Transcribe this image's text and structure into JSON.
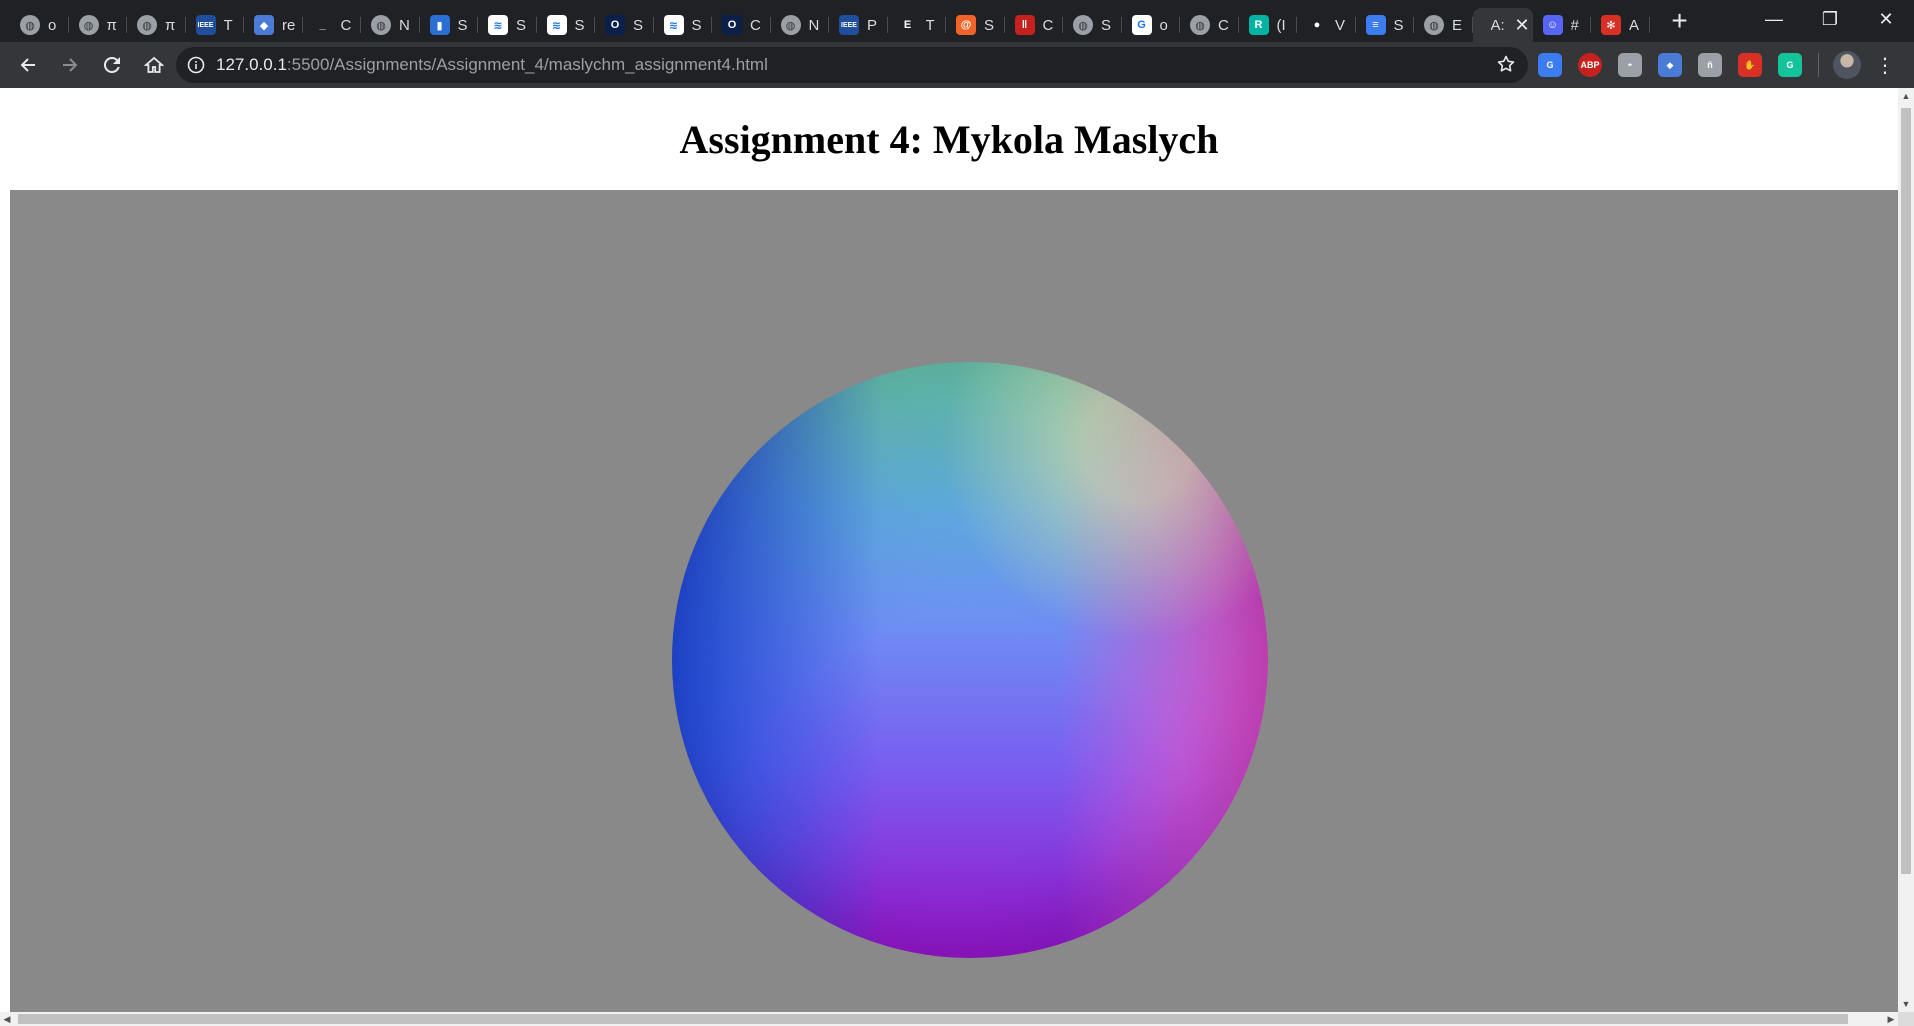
{
  "browser": {
    "tabs": [
      {
        "title": "o",
        "icon": "globe-icon",
        "color": "#5f6368",
        "glyph": "◍"
      },
      {
        "title": "π",
        "icon": "globe-icon",
        "color": "#5f6368",
        "glyph": "◍"
      },
      {
        "title": "π",
        "icon": "globe-icon",
        "color": "#5f6368",
        "glyph": "◍"
      },
      {
        "title": "T",
        "icon": "ieee-icon",
        "color": "#1f4e9c",
        "glyph": "IEEE"
      },
      {
        "title": "re",
        "icon": "graduation-cap-icon",
        "color": "#4a7bd6",
        "glyph": "◆"
      },
      {
        "title": "C",
        "icon": "underscore-icon",
        "color": "#202124",
        "glyph": "_"
      },
      {
        "title": "N",
        "icon": "globe-icon",
        "color": "#5f6368",
        "glyph": "◍"
      },
      {
        "title": "S",
        "icon": "bar-chart-icon",
        "color": "#2a6fd4",
        "glyph": "▮"
      },
      {
        "title": "S",
        "icon": "stack-icon",
        "color": "#ffffff",
        "glyph": "≋"
      },
      {
        "title": "S",
        "icon": "stack-icon",
        "color": "#ffffff",
        "glyph": "≋"
      },
      {
        "title": "S",
        "icon": "o-letter-icon",
        "color": "#0b1f4b",
        "glyph": "O"
      },
      {
        "title": "S",
        "icon": "stack-icon",
        "color": "#ffffff",
        "glyph": "≋"
      },
      {
        "title": "C",
        "icon": "o-letter-icon",
        "color": "#0b1f4b",
        "glyph": "O"
      },
      {
        "title": "N",
        "icon": "globe-icon",
        "color": "#5f6368",
        "glyph": "◍"
      },
      {
        "title": "P",
        "icon": "ieee-icon",
        "color": "#1f4e9c",
        "glyph": "IEEE"
      },
      {
        "title": "T",
        "icon": "e-letter-icon",
        "color": "#202124",
        "glyph": "E"
      },
      {
        "title": "S",
        "icon": "at-icon",
        "color": "#f0642a",
        "glyph": "@"
      },
      {
        "title": "C",
        "icon": "pause-bars-icon",
        "color": "#c5221f",
        "glyph": "‖"
      },
      {
        "title": "S",
        "icon": "globe-icon",
        "color": "#5f6368",
        "glyph": "◍"
      },
      {
        "title": "o",
        "icon": "google-icon",
        "color": "#ffffff",
        "glyph": "G"
      },
      {
        "title": "C",
        "icon": "globe-icon",
        "color": "#5f6368",
        "glyph": "◍"
      },
      {
        "title": "(I",
        "icon": "researchgate-icon",
        "color": "#00b3a4",
        "glyph": "R"
      },
      {
        "title": "V",
        "icon": "github-icon",
        "color": "#202124",
        "glyph": "●"
      },
      {
        "title": "S",
        "icon": "docs-icon",
        "color": "#3b7cf0",
        "glyph": "≡"
      },
      {
        "title": "E",
        "icon": "globe-icon",
        "color": "#5f6368",
        "glyph": "◍"
      },
      {
        "title": "A:",
        "icon": "",
        "color": "",
        "glyph": "",
        "active": true
      },
      {
        "title": "#",
        "icon": "discord-icon",
        "color": "#5865f2",
        "glyph": "☺"
      },
      {
        "title": "A",
        "icon": "lifebuoy-icon",
        "color": "#d93025",
        "glyph": "✻"
      }
    ],
    "new_tab_label": "+",
    "window_controls": {
      "minimize": "—",
      "restore": "❐",
      "close": "✕"
    },
    "url_host": "127.0.0.1",
    "url_path": ":5500/Assignments/Assignment_4/maslychm_assignment4.html",
    "extensions": [
      {
        "icon": "google-translate-icon",
        "color": "#3b7cf0",
        "glyph": "G"
      },
      {
        "icon": "adblock-plus-icon",
        "color": "#c5221f",
        "glyph": "ABP"
      },
      {
        "icon": "hat-icon",
        "color": "#9aa0a6",
        "glyph": "◓"
      },
      {
        "icon": "graduation-cap-icon",
        "color": "#4a7bd6",
        "glyph": "◆"
      },
      {
        "icon": "puzzle-icon",
        "color": "#9aa0a6",
        "glyph": "ñ"
      },
      {
        "icon": "stop-hand-icon",
        "color": "#d93025",
        "glyph": "✋"
      },
      {
        "icon": "grammarly-icon",
        "color": "#15c39a",
        "glyph": "G"
      }
    ]
  },
  "page": {
    "title": "Assignment 4: Mykola Maslych",
    "canvas_background": "#898989"
  }
}
